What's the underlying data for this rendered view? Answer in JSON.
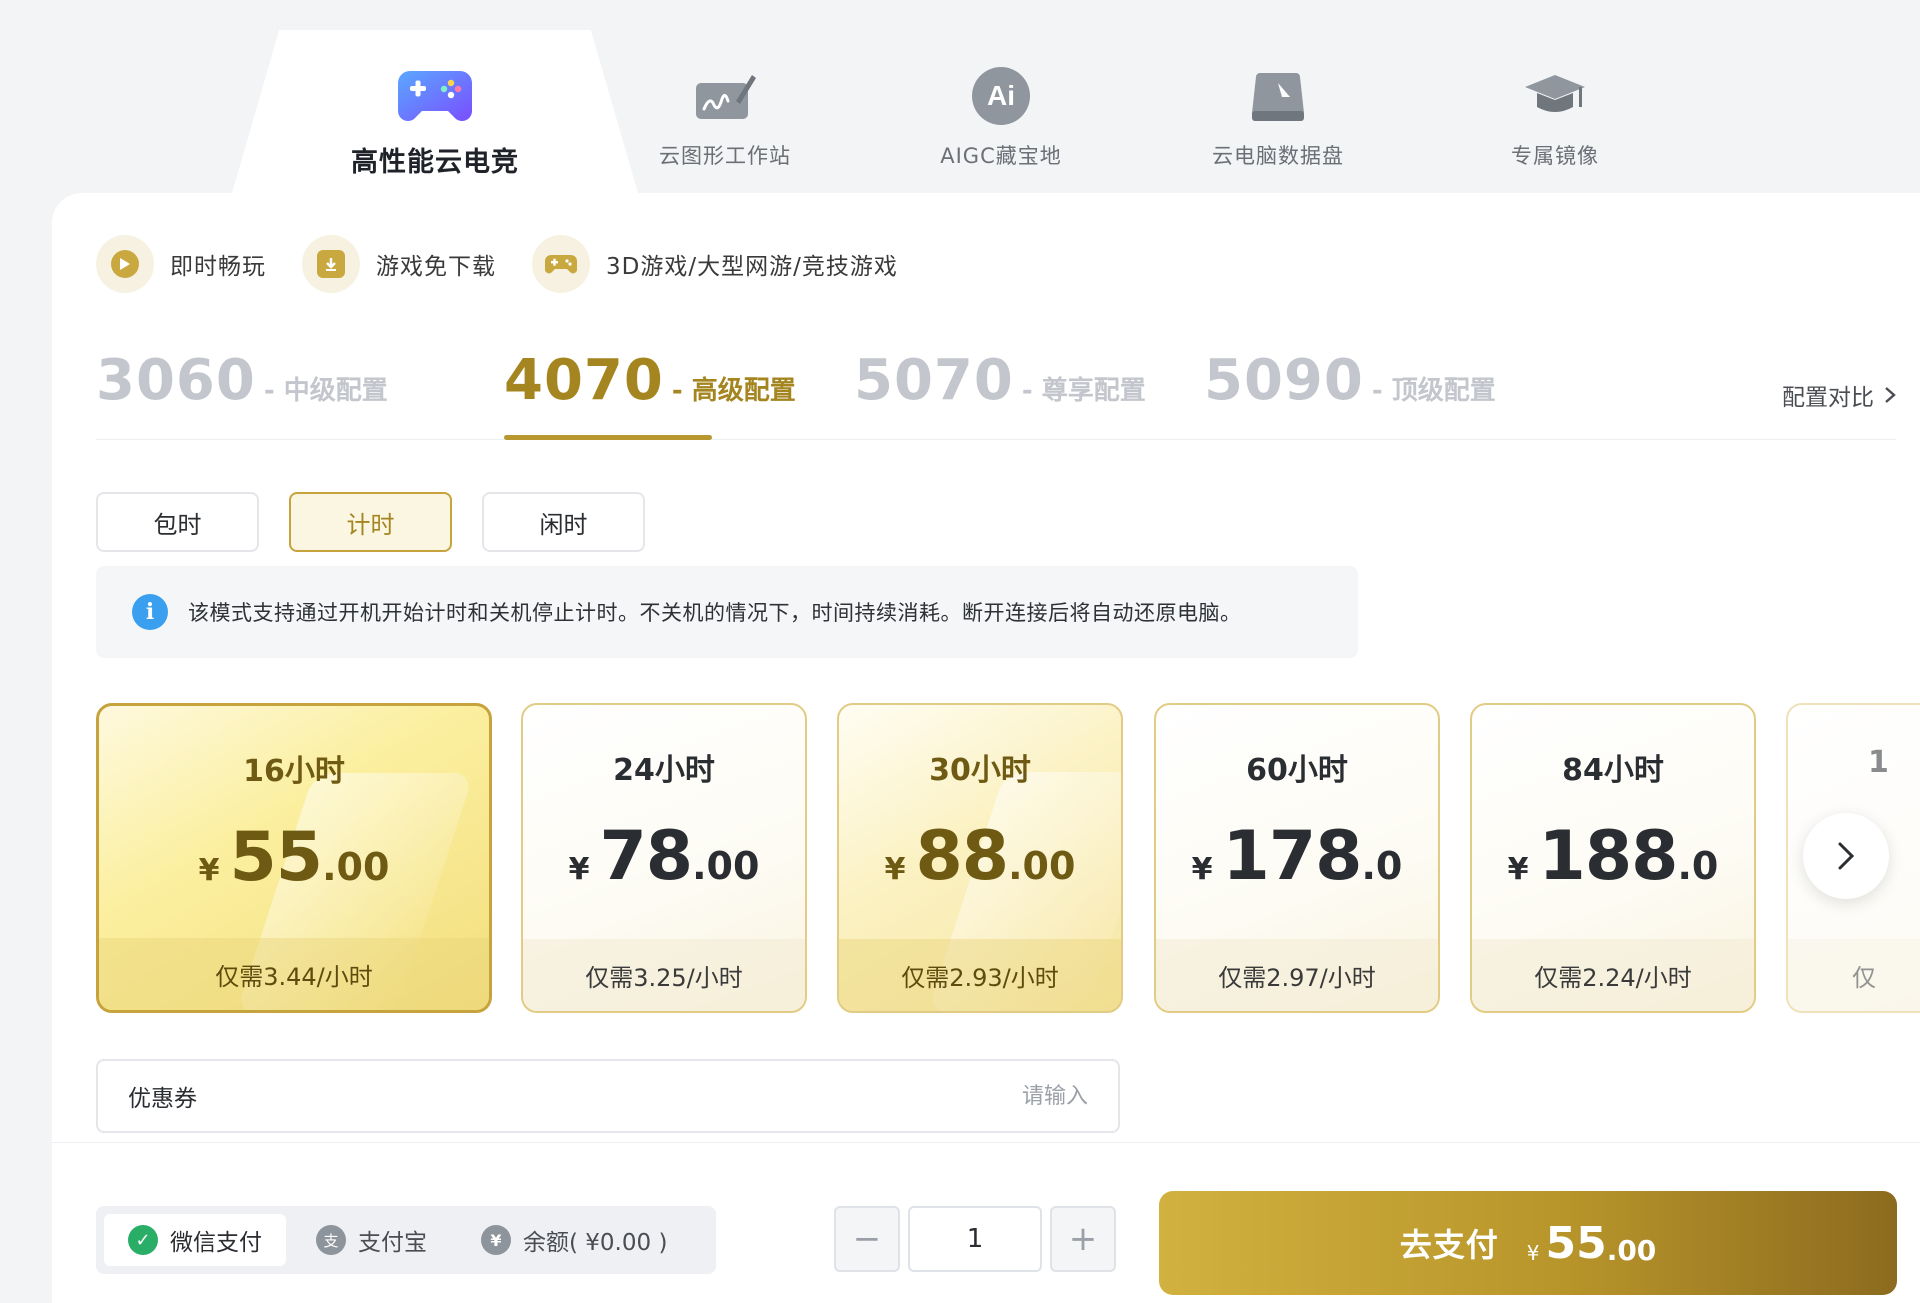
{
  "top_tabs": [
    {
      "label": "高性能云电竞",
      "icon": "gamepad-icon",
      "active": true
    },
    {
      "label": "云图形工作站",
      "icon": "drawing-tablet-icon",
      "active": false
    },
    {
      "label": "AIGC藏宝地",
      "icon": "ai-icon",
      "ai_text": "Ai",
      "active": false
    },
    {
      "label": "云电脑数据盘",
      "icon": "hard-disk-icon",
      "active": false
    },
    {
      "label": "专属镜像",
      "icon": "graduation-cap-icon",
      "active": false
    }
  ],
  "features": [
    {
      "label": "即时畅玩",
      "icon": "play-icon"
    },
    {
      "label": "游戏免下载",
      "icon": "download-icon"
    },
    {
      "label": "3D游戏/大型网游/竞技游戏",
      "icon": "gamepad-icon"
    }
  ],
  "configs": [
    {
      "num": "3060",
      "sub": "- 中级配置",
      "active": false
    },
    {
      "num": "4070",
      "sub": "- 高级配置",
      "active": true
    },
    {
      "num": "5070",
      "sub": "- 尊享配置",
      "active": false
    },
    {
      "num": "5090",
      "sub": "- 顶级配置",
      "active": false
    }
  ],
  "compare_label": "配置对比",
  "modes": [
    {
      "label": "包时",
      "active": false
    },
    {
      "label": "计时",
      "active": true
    },
    {
      "label": "闲时",
      "active": false
    }
  ],
  "info": {
    "icon_text": "i",
    "text": "该模式支持通过开机开始计时和关机停止计时。不关机的情况下，时间持续消耗。断开连接后将自动还原电脑。"
  },
  "packages": [
    {
      "hours": "16小时",
      "currency": "¥",
      "price_int": "55",
      "price_dec": ".00",
      "unit": "仅需3.44/小时",
      "style": "selected"
    },
    {
      "hours": "24小时",
      "currency": "¥",
      "price_int": "78",
      "price_dec": ".00",
      "unit": "仅需3.25/小时",
      "style": "plain"
    },
    {
      "hours": "30小时",
      "currency": "¥",
      "price_int": "88",
      "price_dec": ".00",
      "unit": "仅需2.93/小时",
      "style": "gold"
    },
    {
      "hours": "60小时",
      "currency": "¥",
      "price_int": "178",
      "price_dec": ".0",
      "unit": "仅需2.97/小时",
      "style": "plain"
    },
    {
      "hours": "84小时",
      "currency": "¥",
      "price_int": "188",
      "price_dec": ".0",
      "unit": "仅需2.24/小时",
      "style": "plain"
    },
    {
      "hours": "1",
      "currency": "",
      "price_int": "",
      "price_dec": "",
      "unit": "仅",
      "style": "partial"
    }
  ],
  "coupon": {
    "label": "优惠券",
    "placeholder": "请输入"
  },
  "payment_methods": [
    {
      "label": "微信支付",
      "icon": "wechat-pay-icon",
      "glyph": "✓",
      "color": "#2aae67",
      "active": true
    },
    {
      "label": "支付宝",
      "icon": "alipay-icon",
      "glyph": "支",
      "color": "#8e949c",
      "active": false
    },
    {
      "label": "余额( ¥0.00 )",
      "icon": "balance-icon",
      "glyph": "¥",
      "color": "#8e949c",
      "active": false
    }
  ],
  "quantity": {
    "minus": "−",
    "value": "1",
    "plus": "+"
  },
  "pay_button": {
    "label": "去支付",
    "currency": "¥",
    "amount_int": "55",
    "amount_dec": ".00"
  }
}
